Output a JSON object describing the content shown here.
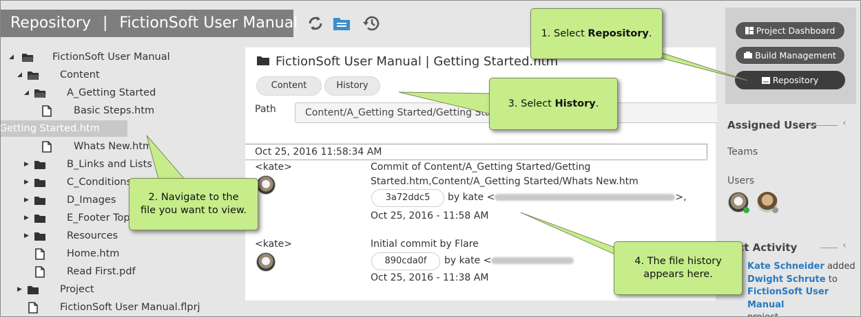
{
  "title": {
    "repo": "Repository",
    "sep": "|",
    "project": "FictionSoft User Manual"
  },
  "toolbar": {
    "icons": [
      "sync-icon",
      "folder-icon",
      "history-icon"
    ]
  },
  "tree": [
    {
      "label": "FictionSoft User Manual",
      "type": "folder",
      "expanded": true
    },
    {
      "label": "Content",
      "type": "folder",
      "expanded": true
    },
    {
      "label": "A_Getting Started",
      "type": "folder",
      "expanded": true
    },
    {
      "label": "Basic Steps.htm",
      "type": "file"
    },
    {
      "label": "Getting Started.htm",
      "type": "file",
      "selected": true
    },
    {
      "label": "Whats New.htm",
      "type": "file"
    },
    {
      "label": "B_Links and Lists",
      "type": "folder"
    },
    {
      "label": "C_Conditions",
      "type": "folder"
    },
    {
      "label": "D_Images",
      "type": "folder"
    },
    {
      "label": "E_Footer Topics",
      "type": "folder"
    },
    {
      "label": "Resources",
      "type": "folder"
    },
    {
      "label": "Home.htm",
      "type": "file"
    },
    {
      "label": "Read First.pdf",
      "type": "file"
    },
    {
      "label": "Project",
      "type": "folder"
    },
    {
      "label": "FictionSoft User Manual.flprj",
      "type": "file"
    }
  ],
  "main": {
    "file_title": "FictionSoft User Manual  |  Getting Started.htm",
    "tabs": [
      "Content",
      "History"
    ],
    "path_label": "Path",
    "path_value": "Content/A_Getting Started/Getting Started.htm",
    "history_header": "Oct 25, 2016 11:58:34 AM",
    "commits": [
      {
        "user": "<kate>",
        "message_line1": "Commit of Content/A_Getting Started/Getting",
        "message_line2": "Started.htm,Content/A_Getting Started/Whats New.htm",
        "hash": "3a72ddc5",
        "by": "by kate <",
        "by_end": ">,",
        "date": "Oct 25, 2016 - 11:58 AM"
      },
      {
        "user": "<kate>",
        "message_line1": "Initial commit by Flare",
        "hash": "890cda0f",
        "by": "by kate <",
        "date": "Oct 25, 2016 - 11:38 AM"
      }
    ]
  },
  "right": {
    "buttons": [
      "Project Dashboard",
      "Build Management",
      "Repository"
    ],
    "assigned_users": "Assigned Users",
    "teams": "Teams",
    "users": "Users",
    "activity_title": "ject Activity",
    "activity": {
      "user": "Kate Schneider",
      "verb": "added",
      "target": "Dwight Schrute",
      "to": "to",
      "project": "FictionSoft User Manual",
      "suffix": "project"
    }
  },
  "callouts": {
    "c1_prefix": "1. Select ",
    "c1_bold": "Repository",
    "c1_suffix": ".",
    "c2": "2. Navigate to the file you want to view.",
    "c3_prefix": "3. Select ",
    "c3_bold": "History",
    "c3_suffix": ".",
    "c4": "4. The file history appears here."
  },
  "colors": {
    "callout": "#c6ed8a",
    "titlebar": "#7e7e7e",
    "link": "#2a7ac0"
  }
}
